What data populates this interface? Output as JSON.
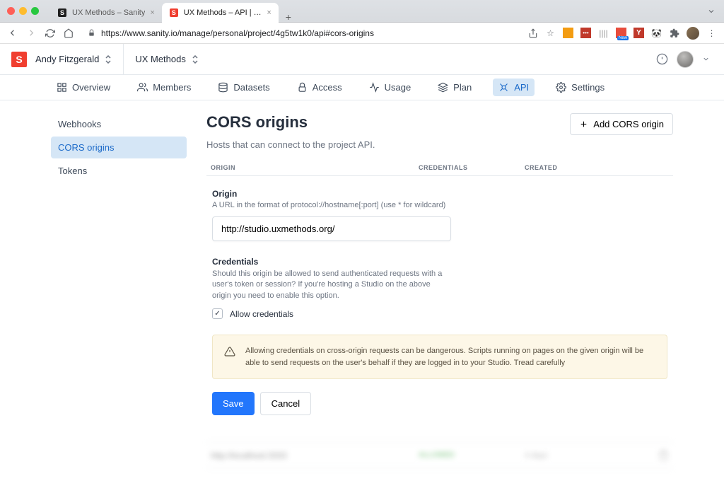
{
  "browser": {
    "tabs": [
      {
        "title": "UX Methods – Sanity",
        "active": false
      },
      {
        "title": "UX Methods – API | Sanity.io",
        "active": true
      }
    ],
    "url": "https://www.sanity.io/manage/personal/project/4g5tw1k0/api#cors-origins"
  },
  "header": {
    "org": "Andy Fitzgerald",
    "project": "UX Methods"
  },
  "nav": {
    "overview": "Overview",
    "members": "Members",
    "datasets": "Datasets",
    "access": "Access",
    "usage": "Usage",
    "plan": "Plan",
    "api": "API",
    "settings": "Settings"
  },
  "sidebar": {
    "webhooks": "Webhooks",
    "cors": "CORS origins",
    "tokens": "Tokens"
  },
  "page": {
    "title": "CORS origins",
    "subtitle": "Hosts that can connect to the project API.",
    "add_button": "Add CORS origin",
    "columns": {
      "origin": "ORIGIN",
      "credentials": "CREDENTIALS",
      "created": "CREATED"
    }
  },
  "form": {
    "origin_label": "Origin",
    "origin_hint": "A URL in the format of protocol://hostname[:port] (use * for wildcard)",
    "origin_value": "http://studio.uxmethods.org/",
    "credentials_label": "Credentials",
    "credentials_hint": "Should this origin be allowed to send authenticated requests with a user's token or session? If you're hosting a Studio on the above origin you need to enable this option.",
    "allow_credentials": "Allow credentials",
    "alert": "Allowing credentials on cross-origin requests can be dangerous. Scripts running on pages on the given origin will be able to send requests on the user's behalf if they are logged in to your Studio. Tread carefully",
    "save": "Save",
    "cancel": "Cancel"
  },
  "existing_row": {
    "origin": "http://localhost:3333",
    "credential": "ALLOWED",
    "created": "4 days"
  }
}
